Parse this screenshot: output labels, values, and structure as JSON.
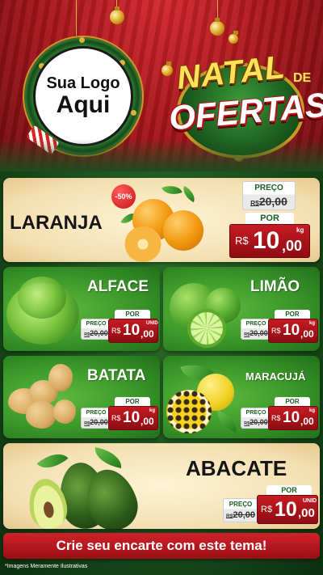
{
  "header": {
    "logo_line1": "Sua Logo",
    "logo_line2": "Aqui",
    "title_natal": "NATAL",
    "title_de": "DE",
    "title_ofertas": "OFERTAS"
  },
  "featured": {
    "name": "LARANJA",
    "discount_badge": "-50%",
    "preco_label": "PREÇO",
    "old_currency": "R$",
    "old_price": "20,00",
    "por_label": "POR",
    "currency": "R$",
    "price_int": "10",
    "price_dec": ",00",
    "unit": "kg"
  },
  "products": [
    {
      "name": "ALFACE",
      "preco_label": "PREÇO",
      "old_currency": "R$",
      "old_price": "20,00",
      "por_label": "POR",
      "currency": "R$",
      "price_int": "10",
      "price_dec": ",00",
      "unit": "UNID"
    },
    {
      "name": "LIMÃO",
      "preco_label": "PREÇO",
      "old_currency": "R$",
      "old_price": "20,00",
      "por_label": "POR",
      "currency": "R$",
      "price_int": "10",
      "price_dec": ",00",
      "unit": "kg"
    },
    {
      "name": "BATATA",
      "preco_label": "PREÇO",
      "old_currency": "R$",
      "old_price": "20,00",
      "por_label": "POR",
      "currency": "R$",
      "price_int": "10",
      "price_dec": ",00",
      "unit": "kg"
    },
    {
      "name": "MARACUJÁ",
      "preco_label": "PREÇO",
      "old_currency": "R$",
      "old_price": "20,00",
      "por_label": "POR",
      "currency": "R$",
      "price_int": "10",
      "price_dec": ",00",
      "unit": "kg"
    }
  ],
  "bottom_product": {
    "name": "ABACATE",
    "preco_label": "PREÇO",
    "old_currency": "R$",
    "old_price": "20,00",
    "por_label": "POR",
    "currency": "R$",
    "price_int": "10",
    "price_dec": ",00",
    "unit": "UNID"
  },
  "footer": {
    "cta": "Crie seu encarte com este tema!",
    "disclaimer": "*Imagens Meramente Ilustrativas"
  },
  "colors": {
    "header_red": "#a3141a",
    "card_green": "#3c9a2a",
    "card_cream": "#f3dfb0",
    "price_red": "#c61b22",
    "gold": "#ffe15a"
  },
  "icons": {
    "ornament": "christmas-ball-icon",
    "wreath": "christmas-wreath-icon"
  }
}
